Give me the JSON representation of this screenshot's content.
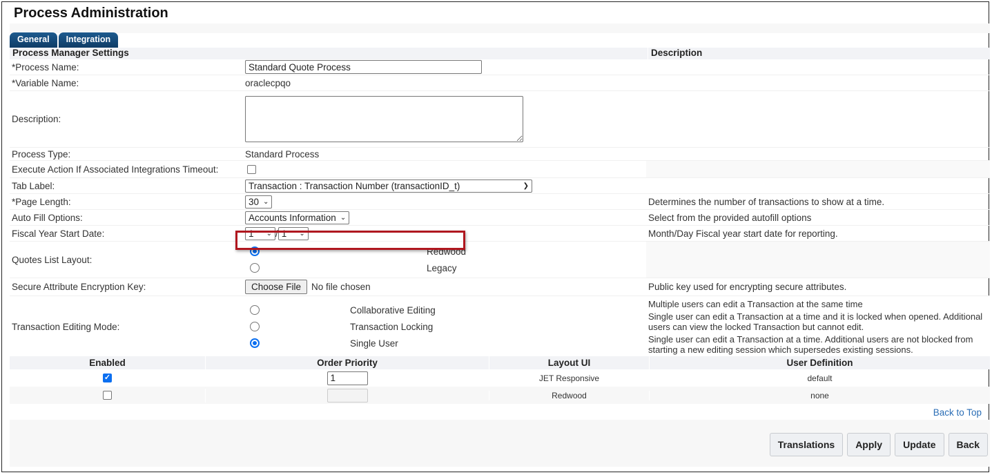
{
  "page": {
    "title": "Process Administration"
  },
  "tabs": [
    {
      "label": "General"
    },
    {
      "label": "Integration"
    }
  ],
  "section": {
    "header": "Process Manager Settings",
    "desc_header": "Description"
  },
  "fields": {
    "process_name": {
      "label": "*Process Name:",
      "value": "Standard Quote Process"
    },
    "variable_name": {
      "label": "*Variable Name:",
      "value": "oraclecpqo"
    },
    "description": {
      "label": "Description:",
      "value": ""
    },
    "process_type": {
      "label": "Process Type:",
      "value": "Standard Process"
    },
    "execute_action": {
      "label": "Execute Action If Associated Integrations Timeout:",
      "checked": false
    },
    "tab_label": {
      "label": "Tab Label:",
      "selected": "Transaction : Transaction Number (transactionID_t)"
    },
    "page_length": {
      "label": "*Page Length:",
      "selected": "30",
      "description": "Determines the number of transactions to show at a time."
    },
    "auto_fill": {
      "label": "Auto Fill Options:",
      "selected": "Accounts Information",
      "description": "Select from the provided autofill options"
    },
    "fiscal_year": {
      "label": "Fiscal Year Start Date:",
      "month": "1",
      "separator": "/",
      "day": "1",
      "description": "Month/Day Fiscal year start date for reporting."
    },
    "quotes_layout": {
      "label": "Quotes List Layout:",
      "options": [
        {
          "label": "Redwood",
          "selected": true
        },
        {
          "label": "Legacy",
          "selected": false
        }
      ]
    },
    "encryption_key": {
      "label": "Secure Attribute Encryption Key:",
      "button": "Choose File",
      "status": "No file chosen",
      "description": "Public key used for encrypting secure attributes."
    },
    "editing_mode": {
      "label": "Transaction Editing Mode:",
      "options": [
        {
          "label": "Collaborative Editing",
          "selected": false,
          "description": "Multiple users can edit a Transaction at the same time"
        },
        {
          "label": "Transaction Locking",
          "selected": false,
          "description": "Single user can edit a Transaction at a time and it is locked when opened. Additional users can view the locked Transaction but cannot edit."
        },
        {
          "label": "Single User",
          "selected": true,
          "description": "Single user can edit a Transaction at a time. Additional users are not blocked from starting a new editing session which supersedes existing sessions."
        }
      ]
    }
  },
  "layout_table": {
    "headers": [
      "Enabled",
      "Order Priority",
      "Layout UI",
      "User Definition"
    ],
    "rows": [
      {
        "enabled": true,
        "order_priority": "1",
        "layout_ui": "JET Responsive",
        "user_definition": "default"
      },
      {
        "enabled": false,
        "order_priority": "",
        "layout_ui": "Redwood",
        "user_definition": "none"
      }
    ]
  },
  "links": {
    "back_to_top": "Back to Top"
  },
  "buttons": {
    "translations": "Translations",
    "apply": "Apply",
    "update": "Update",
    "back": "Back"
  },
  "colors": {
    "tab": "#0f3c66",
    "accent": "#0b6ff0",
    "highlight": "#b0171f",
    "link": "#2a6db5"
  }
}
